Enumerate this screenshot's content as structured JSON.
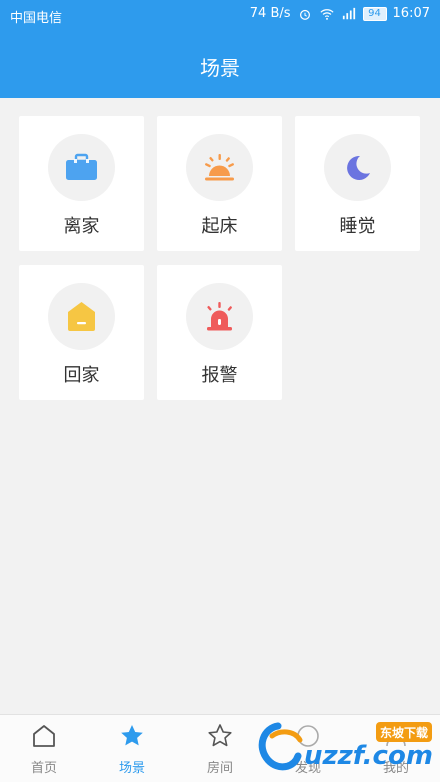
{
  "status_bar": {
    "carrier": "中国电信",
    "speed": "74 B/s",
    "battery": "94",
    "time": "16:07"
  },
  "header": {
    "title": "场景"
  },
  "scenes": [
    {
      "label": "离家",
      "icon": "briefcase-icon",
      "color": "#4da3f0"
    },
    {
      "label": "起床",
      "icon": "sunrise-icon",
      "color": "#f79b4b"
    },
    {
      "label": "睡觉",
      "icon": "moon-icon",
      "color": "#6b74e0"
    },
    {
      "label": "回家",
      "icon": "house-icon",
      "color": "#f6c643"
    },
    {
      "label": "报警",
      "icon": "alarm-icon",
      "color": "#ef5b5b"
    }
  ],
  "bottom_nav": {
    "active_color": "#2e9bed",
    "tabs": [
      {
        "label": "首页",
        "icon": "home-icon"
      },
      {
        "label": "场景",
        "icon": "star-icon",
        "active": true
      },
      {
        "label": "房间",
        "icon": "star-outline-icon"
      },
      {
        "label": "发现",
        "icon": "discover-icon"
      },
      {
        "label": "我的",
        "icon": "profile-icon"
      }
    ]
  },
  "watermark": {
    "text": "uzzf.com",
    "badge": "东坡下载"
  }
}
